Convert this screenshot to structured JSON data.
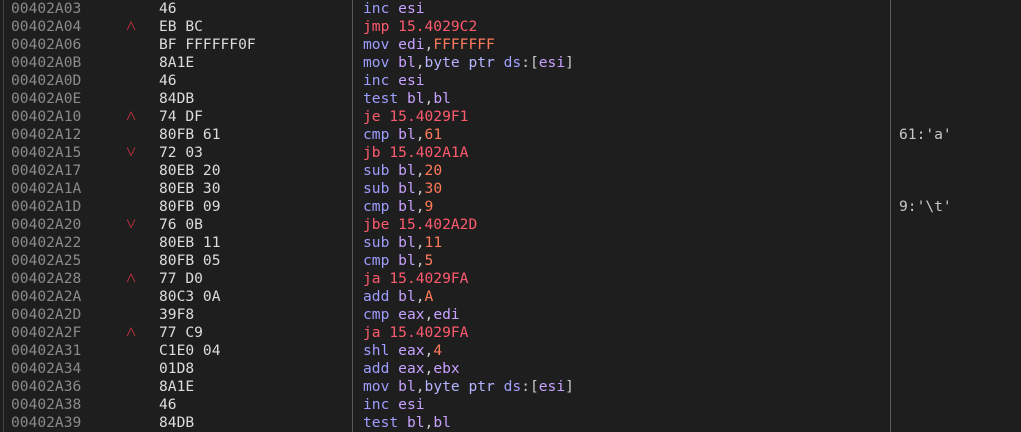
{
  "rows": [
    {
      "addr": "00402A03",
      "arrow": "",
      "bytes": "46",
      "instr": [
        [
          "inc",
          "mn"
        ],
        [
          " ",
          ""
        ],
        [
          "esi",
          "reg"
        ]
      ],
      "comment": ""
    },
    {
      "addr": "00402A04",
      "arrow": "up",
      "bytes": "EB BC",
      "instr": [
        [
          "jmp",
          "j"
        ],
        [
          " ",
          ""
        ],
        [
          "15.4029C2",
          "j"
        ]
      ],
      "comment": ""
    },
    {
      "addr": "00402A06",
      "arrow": "",
      "bytes": "BF FFFFFF0F",
      "instr": [
        [
          "mov",
          "mn"
        ],
        [
          " ",
          ""
        ],
        [
          "edi",
          "reg"
        ],
        [
          ",",
          "op"
        ],
        [
          "FFFFFFF",
          "num"
        ]
      ],
      "comment": ""
    },
    {
      "addr": "00402A0B",
      "arrow": "",
      "bytes": "8A1E",
      "instr": [
        [
          "mov",
          "mn"
        ],
        [
          " ",
          ""
        ],
        [
          "bl",
          "reg"
        ],
        [
          ",",
          "op"
        ],
        [
          "byte ptr ",
          "kw"
        ],
        [
          "ds",
          "seg"
        ],
        [
          ":[",
          "op"
        ],
        [
          "esi",
          "reg"
        ],
        [
          "]",
          "op"
        ]
      ],
      "comment": ""
    },
    {
      "addr": "00402A0D",
      "arrow": "",
      "bytes": "46",
      "instr": [
        [
          "inc",
          "mn"
        ],
        [
          " ",
          ""
        ],
        [
          "esi",
          "reg"
        ]
      ],
      "comment": ""
    },
    {
      "addr": "00402A0E",
      "arrow": "",
      "bytes": "84DB",
      "instr": [
        [
          "test",
          "mn"
        ],
        [
          " ",
          ""
        ],
        [
          "bl",
          "reg"
        ],
        [
          ",",
          "op"
        ],
        [
          "bl",
          "reg"
        ]
      ],
      "comment": ""
    },
    {
      "addr": "00402A10",
      "arrow": "up",
      "bytes": "74 DF",
      "instr": [
        [
          "je",
          "j"
        ],
        [
          " ",
          ""
        ],
        [
          "15.4029F1",
          "j"
        ]
      ],
      "comment": ""
    },
    {
      "addr": "00402A12",
      "arrow": "",
      "bytes": "80FB 61",
      "instr": [
        [
          "cmp",
          "mn"
        ],
        [
          " ",
          ""
        ],
        [
          "bl",
          "reg"
        ],
        [
          ",",
          "op"
        ],
        [
          "61",
          "num"
        ]
      ],
      "comment": "61:'a'"
    },
    {
      "addr": "00402A15",
      "arrow": "down",
      "bytes": "72 03",
      "instr": [
        [
          "jb",
          "j"
        ],
        [
          " ",
          ""
        ],
        [
          "15.402A1A",
          "j"
        ]
      ],
      "comment": ""
    },
    {
      "addr": "00402A17",
      "arrow": "",
      "bytes": "80EB 20",
      "instr": [
        [
          "sub",
          "mn"
        ],
        [
          " ",
          ""
        ],
        [
          "bl",
          "reg"
        ],
        [
          ",",
          "op"
        ],
        [
          "20",
          "num"
        ]
      ],
      "comment": ""
    },
    {
      "addr": "00402A1A",
      "arrow": "",
      "bytes": "80EB 30",
      "instr": [
        [
          "sub",
          "mn"
        ],
        [
          " ",
          ""
        ],
        [
          "bl",
          "reg"
        ],
        [
          ",",
          "op"
        ],
        [
          "30",
          "num"
        ]
      ],
      "comment": ""
    },
    {
      "addr": "00402A1D",
      "arrow": "",
      "bytes": "80FB 09",
      "instr": [
        [
          "cmp",
          "mn"
        ],
        [
          " ",
          ""
        ],
        [
          "bl",
          "reg"
        ],
        [
          ",",
          "op"
        ],
        [
          "9",
          "num"
        ]
      ],
      "comment": "9:'\\t'"
    },
    {
      "addr": "00402A20",
      "arrow": "down",
      "bytes": "76 0B",
      "instr": [
        [
          "jbe",
          "j"
        ],
        [
          " ",
          ""
        ],
        [
          "15.402A2D",
          "j"
        ]
      ],
      "comment": ""
    },
    {
      "addr": "00402A22",
      "arrow": "",
      "bytes": "80EB 11",
      "instr": [
        [
          "sub",
          "mn"
        ],
        [
          " ",
          ""
        ],
        [
          "bl",
          "reg"
        ],
        [
          ",",
          "op"
        ],
        [
          "11",
          "num"
        ]
      ],
      "comment": ""
    },
    {
      "addr": "00402A25",
      "arrow": "",
      "bytes": "80FB 05",
      "instr": [
        [
          "cmp",
          "mn"
        ],
        [
          " ",
          ""
        ],
        [
          "bl",
          "reg"
        ],
        [
          ",",
          "op"
        ],
        [
          "5",
          "num"
        ]
      ],
      "comment": ""
    },
    {
      "addr": "00402A28",
      "arrow": "up",
      "bytes": "77 D0",
      "instr": [
        [
          "ja",
          "j"
        ],
        [
          " ",
          ""
        ],
        [
          "15.4029FA",
          "j"
        ]
      ],
      "comment": ""
    },
    {
      "addr": "00402A2A",
      "arrow": "",
      "bytes": "80C3 0A",
      "instr": [
        [
          "add",
          "mn"
        ],
        [
          " ",
          ""
        ],
        [
          "bl",
          "reg"
        ],
        [
          ",",
          "op"
        ],
        [
          "A",
          "num"
        ]
      ],
      "comment": ""
    },
    {
      "addr": "00402A2D",
      "arrow": "",
      "bytes": "39F8",
      "instr": [
        [
          "cmp",
          "mn"
        ],
        [
          " ",
          ""
        ],
        [
          "eax",
          "reg"
        ],
        [
          ",",
          "op"
        ],
        [
          "edi",
          "reg"
        ]
      ],
      "comment": ""
    },
    {
      "addr": "00402A2F",
      "arrow": "up",
      "bytes": "77 C9",
      "instr": [
        [
          "ja",
          "j"
        ],
        [
          " ",
          ""
        ],
        [
          "15.4029FA",
          "j"
        ]
      ],
      "comment": ""
    },
    {
      "addr": "00402A31",
      "arrow": "",
      "bytes": "C1E0 04",
      "instr": [
        [
          "shl",
          "mn"
        ],
        [
          " ",
          ""
        ],
        [
          "eax",
          "reg"
        ],
        [
          ",",
          "op"
        ],
        [
          "4",
          "num"
        ]
      ],
      "comment": ""
    },
    {
      "addr": "00402A34",
      "arrow": "",
      "bytes": "01D8",
      "instr": [
        [
          "add",
          "mn"
        ],
        [
          " ",
          ""
        ],
        [
          "eax",
          "reg"
        ],
        [
          ",",
          "op"
        ],
        [
          "ebx",
          "reg"
        ]
      ],
      "comment": ""
    },
    {
      "addr": "00402A36",
      "arrow": "",
      "bytes": "8A1E",
      "instr": [
        [
          "mov",
          "mn"
        ],
        [
          " ",
          ""
        ],
        [
          "bl",
          "reg"
        ],
        [
          ",",
          "op"
        ],
        [
          "byte ptr ",
          "kw"
        ],
        [
          "ds",
          "seg"
        ],
        [
          ":[",
          "op"
        ],
        [
          "esi",
          "reg"
        ],
        [
          "]",
          "op"
        ]
      ],
      "comment": ""
    },
    {
      "addr": "00402A38",
      "arrow": "",
      "bytes": "46",
      "instr": [
        [
          "inc",
          "mn"
        ],
        [
          " ",
          ""
        ],
        [
          "esi",
          "reg"
        ]
      ],
      "comment": ""
    },
    {
      "addr": "00402A39",
      "arrow": "",
      "bytes": "84DB",
      "instr": [
        [
          "test",
          "mn"
        ],
        [
          " ",
          ""
        ],
        [
          "bl",
          "reg"
        ],
        [
          ",",
          "op"
        ],
        [
          "bl",
          "reg"
        ]
      ],
      "comment": ""
    }
  ],
  "arrow_icons": {
    "up": "caret-up-icon",
    "down": "caret-down-icon"
  },
  "colors": {
    "background": "#1e1e1e",
    "address": "#8a8a8a",
    "bytes": "#dcdcdc",
    "mnemonic": "#9d9dff",
    "jump": "#ff5a6e",
    "register": "#c8a2ff",
    "number": "#ff7b5a",
    "arrow": "#d8343f"
  }
}
